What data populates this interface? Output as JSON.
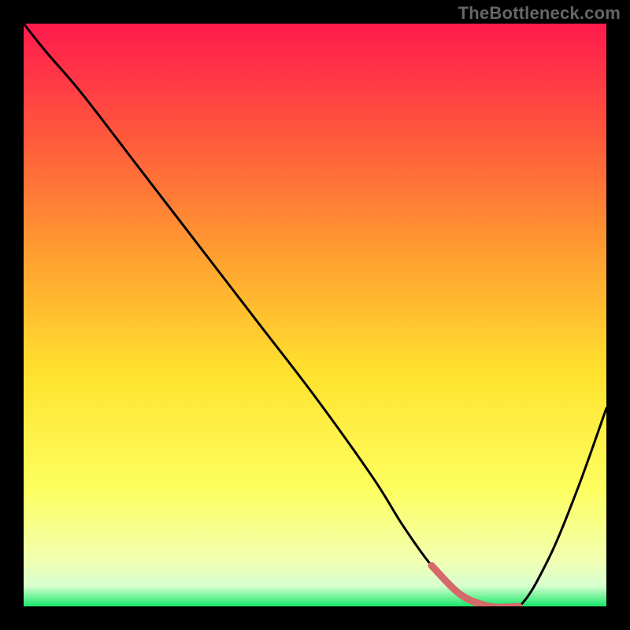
{
  "watermark": "TheBottleneck.com",
  "chart_data": {
    "type": "line",
    "title": "",
    "xlabel": "",
    "ylabel": "",
    "xlim": [
      0,
      100
    ],
    "ylim": [
      0,
      100
    ],
    "series": [
      {
        "name": "curve",
        "x": [
          0,
          4,
          10,
          20,
          30,
          40,
          50,
          60,
          65,
          70,
          75,
          80,
          85,
          90,
          95,
          100
        ],
        "y": [
          100,
          95,
          88,
          75,
          62,
          49,
          36,
          22,
          14,
          7,
          2,
          0,
          0,
          8,
          20,
          34
        ]
      }
    ],
    "highlight": {
      "x0": 70,
      "x1": 85,
      "y0": 0,
      "y1": 3
    },
    "gradient_stops": [
      {
        "pos": 0.0,
        "color": "#ff1a4d"
      },
      {
        "pos": 0.2,
        "color": "#ff5a3c"
      },
      {
        "pos": 0.4,
        "color": "#ffa030"
      },
      {
        "pos": 0.6,
        "color": "#ffe22e"
      },
      {
        "pos": 0.8,
        "color": "#fdff60"
      },
      {
        "pos": 0.92,
        "color": "#f1ffb0"
      },
      {
        "pos": 0.965,
        "color": "#d8ffd0"
      },
      {
        "pos": 1.0,
        "color": "#17e86a"
      }
    ]
  }
}
